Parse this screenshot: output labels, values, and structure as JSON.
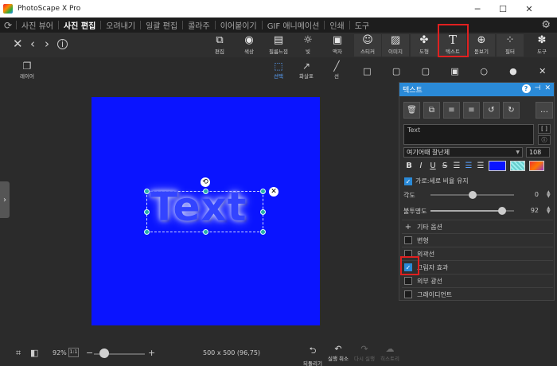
{
  "window": {
    "title": "PhotoScape X Pro"
  },
  "menu": {
    "items": [
      "사진 뷰어",
      "사진 편집",
      "오려내기",
      "일괄 편집",
      "콜라주",
      "이어붙이기",
      "GIF 애니메이션",
      "인쇄",
      "도구"
    ],
    "active": "사진 편집"
  },
  "tools": [
    {
      "label": "편집",
      "icon": "crop-icon"
    },
    {
      "label": "색상",
      "icon": "color-circle-icon"
    },
    {
      "label": "필름느낌",
      "icon": "film-icon"
    },
    {
      "label": "빛",
      "icon": "light-icon"
    },
    {
      "label": "액자",
      "icon": "frame-icon"
    },
    {
      "label": "스티커",
      "icon": "sticker-icon"
    },
    {
      "label": "이미지",
      "icon": "image-icon"
    },
    {
      "label": "도형",
      "icon": "shape-icon"
    },
    {
      "label": "텍스트",
      "icon": "text-tool-icon"
    },
    {
      "label": "돋보기",
      "icon": "magnifier-icon"
    },
    {
      "label": "필터",
      "icon": "filter-icon"
    },
    {
      "label": "도구",
      "icon": "palette-icon"
    }
  ],
  "left": {
    "layer_label": "레이어"
  },
  "subtools": {
    "select_label": "선택",
    "arrow_label": "화살표",
    "line_label": "선"
  },
  "canvas": {
    "sample_text": "Text",
    "color": "#0a14ff"
  },
  "panel": {
    "title": "텍스트",
    "text_value": "Text",
    "font": "여기어때 잘난체",
    "size": "108",
    "keep_ratio_label": "가로:세로 비율 유지",
    "angle_label": "각도",
    "angle_value": "0",
    "opacity_label": "불투명도",
    "opacity_value": "92",
    "extra_label": "기타 옵션",
    "options": [
      "변형",
      "외곽선",
      "그림자 효과",
      "외부 광선",
      "그래이디언트"
    ],
    "checked_option": "그림자 효과",
    "color_swatch": "#0a14ff"
  },
  "bottom": {
    "zoom": "92%",
    "one_to_one": "1:1",
    "dimensions": "500 x 500 (96,75)",
    "revert_label": "되돌리기",
    "undo_label": "실행 취소",
    "redo_label": "다시 실행",
    "history_label": "히스토리"
  },
  "highlight_color": "#e02020",
  "accent_color": "#2a8ad8"
}
